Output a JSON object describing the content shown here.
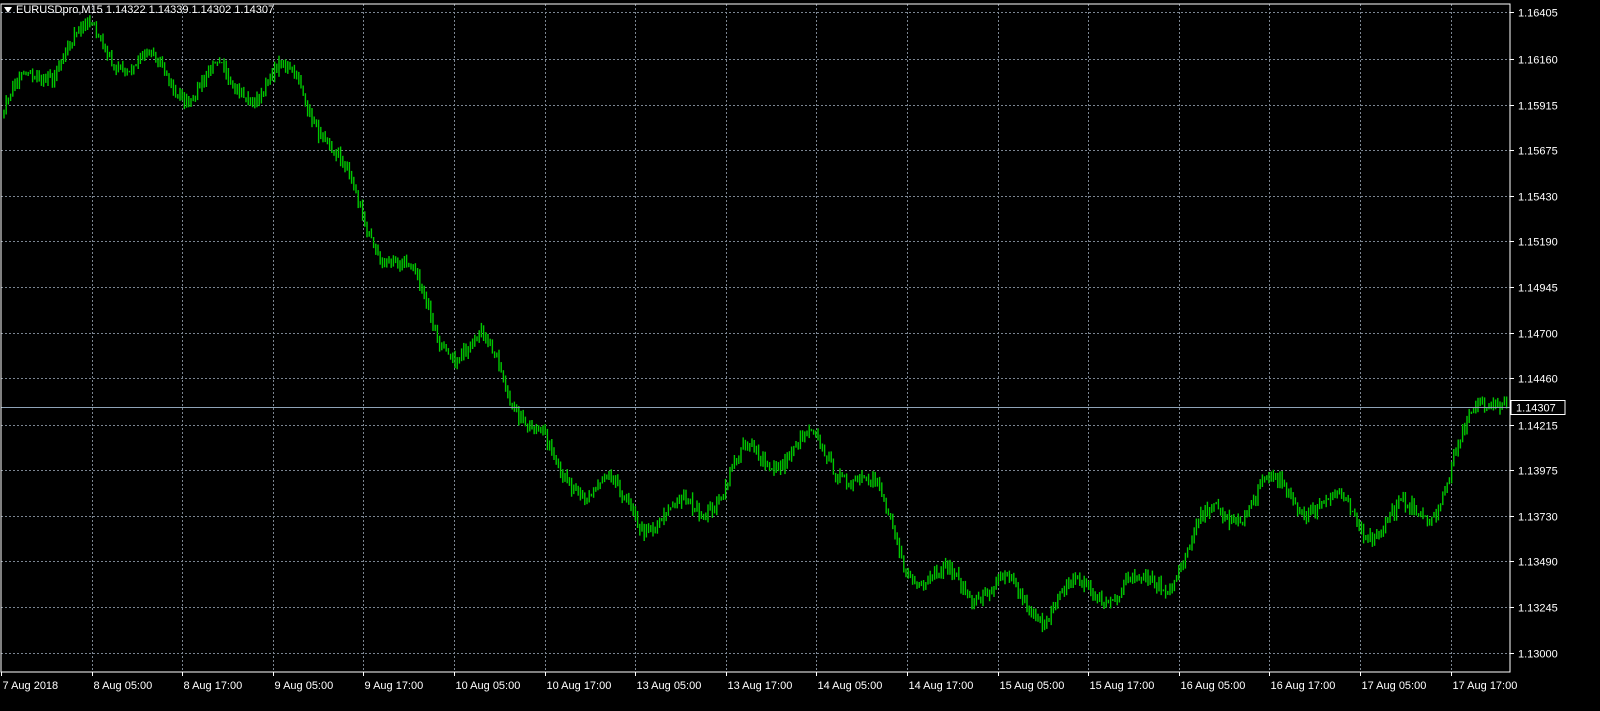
{
  "header": {
    "symbol_line": "EURUSDpro,M15  1.14322 1.14339 1.14302 1.14307",
    "menu_icon": "triangle-down-icon"
  },
  "colors": {
    "background": "#000000",
    "bars": "#00C800",
    "grid": "#7B8591",
    "axis": "#FFFFFF",
    "bid_line": "#8FA3B8"
  },
  "chart_data": {
    "type": "line",
    "symbol": "EURUSDpro",
    "timeframe": "M15",
    "ohlc_last": {
      "open": 1.14322,
      "high": 1.14339,
      "low": 1.14302,
      "close": 1.14307
    },
    "current_price": "1.14307",
    "ylim": [
      1.129,
      1.1645
    ],
    "y_ticks": [
      "1.16405",
      "1.16160",
      "1.15915",
      "1.15675",
      "1.15430",
      "1.15190",
      "1.14945",
      "1.14700",
      "1.14460",
      "1.14215",
      "1.13975",
      "1.13730",
      "1.13490",
      "1.13245",
      "1.13000"
    ],
    "x_ticks": [
      "7 Aug 2018",
      "8 Aug 05:00",
      "8 Aug 17:00",
      "9 Aug 05:00",
      "9 Aug 17:00",
      "10 Aug 05:00",
      "10 Aug 17:00",
      "13 Aug 05:00",
      "13 Aug 17:00",
      "14 Aug 05:00",
      "14 Aug 17:00",
      "15 Aug 05:00",
      "15 Aug 17:00",
      "16 Aug 05:00",
      "16 Aug 17:00",
      "17 Aug 05:00",
      "17 Aug 17:00"
    ],
    "grid": true,
    "series": [
      {
        "x": [
          "7 Aug 2018",
          "8 Aug 05:00",
          "8 Aug 17:00",
          "9 Aug 05:00",
          "9 Aug 17:00",
          "10 Aug 05:00",
          "10 Aug 17:00",
          "13 Aug 05:00",
          "13 Aug 17:00",
          "14 Aug 05:00",
          "14 Aug 17:00",
          "15 Aug 05:00",
          "15 Aug 17:00",
          "16 Aug 05:00",
          "16 Aug 17:00",
          "17 Aug 05:00",
          "17 Aug 17:00"
        ],
        "values": [
          1.159,
          1.1618,
          1.1614,
          1.1595,
          1.1522,
          1.1465,
          1.1384,
          1.1382,
          1.1397,
          1.1398,
          1.1345,
          1.1315,
          1.1343,
          1.1373,
          1.1375,
          1.1382,
          1.1432
        ]
      }
    ]
  }
}
